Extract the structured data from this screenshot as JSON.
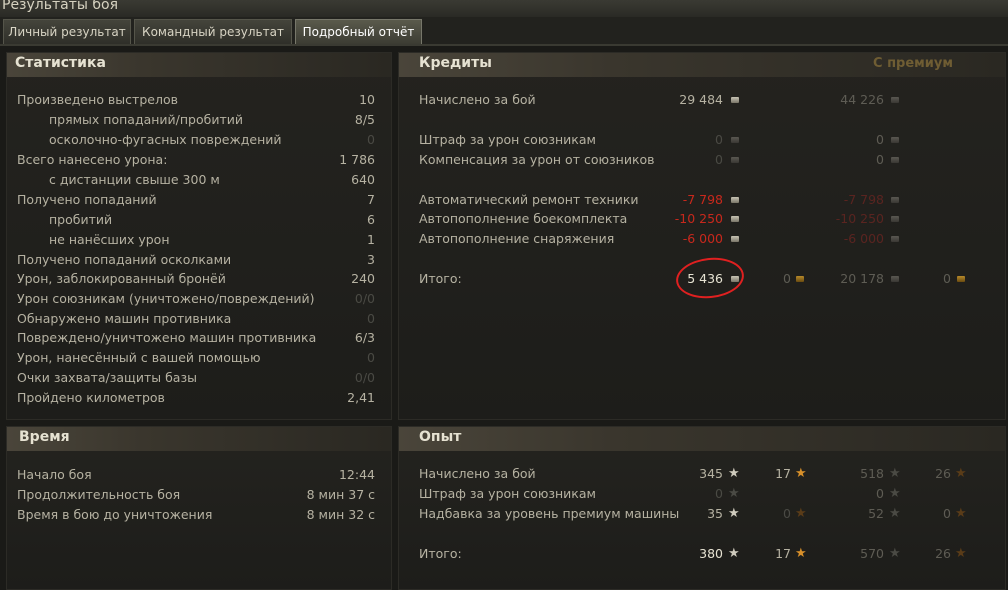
{
  "window": {
    "title": "Результаты боя"
  },
  "tabs": [
    {
      "label": "Личный результат"
    },
    {
      "label": "Командный результат"
    },
    {
      "label": "Подробный отчёт"
    }
  ],
  "stats": {
    "title": "Статистика",
    "rows": [
      {
        "label": "Произведено выстрелов",
        "value": "10"
      },
      {
        "label": "прямых попаданий/пробитий",
        "value": "8/5"
      },
      {
        "label": "осколочно-фугасных повреждений",
        "value": "0"
      },
      {
        "label": "Всего нанесено урона:",
        "value": "1 786"
      },
      {
        "label": "с дистанции свыше 300 м",
        "value": "640"
      },
      {
        "label": "Получено попаданий",
        "value": "7"
      },
      {
        "label": "пробитий",
        "value": "6"
      },
      {
        "label": "не нанёсших урон",
        "value": "1"
      },
      {
        "label": "Получено попаданий осколками",
        "value": "3"
      },
      {
        "label": "Урон, заблокированный бронёй",
        "value": "240"
      },
      {
        "label": "Урон союзникам (уничтожено/повреждений)",
        "value": "0/0"
      },
      {
        "label": "Обнаружено машин противника",
        "value": "0"
      },
      {
        "label": "Повреждено/уничтожено машин противника",
        "value": "6/3"
      },
      {
        "label": "Урон, нанесённый с вашей помощью",
        "value": "0"
      },
      {
        "label": "Очки захвата/защиты базы",
        "value": "0/0"
      },
      {
        "label": "Пройдено километров",
        "value": "2,41"
      }
    ]
  },
  "credits": {
    "title": "Кредиты",
    "premium_label": "С премиум",
    "rows": [
      {
        "label": "Начислено за бой",
        "value": "29 484",
        "premium": "44 226"
      },
      {
        "label": "Штраф за урон союзникам",
        "value": "0",
        "premium": "0"
      },
      {
        "label": "Компенсация за урон от союзников",
        "value": "0",
        "premium": "0"
      },
      {
        "label": "Автоматический ремонт техники",
        "value": "-7 798",
        "premium": "-7 798"
      },
      {
        "label": "Автопополнение боекомплекта",
        "value": "-10 250",
        "premium": "-10 250"
      },
      {
        "label": "Автопополнение снаряжения",
        "value": "-6 000",
        "premium": "-6 000"
      },
      {
        "label": "Итого:",
        "value": "5 436",
        "gold": "0",
        "premium": "20 178",
        "premium_gold": "0"
      }
    ]
  },
  "time": {
    "title": "Время",
    "rows": [
      {
        "label": "Начало боя",
        "value": "12:44"
      },
      {
        "label": "Продолжительность боя",
        "value": "8 мин 37 с"
      },
      {
        "label": "Время в бою до уничтожения",
        "value": "8 мин 32 с"
      }
    ]
  },
  "xp": {
    "title": "Опыт",
    "rows": [
      {
        "label": "Начислено за бой",
        "xp": "345",
        "free": "17",
        "prem_xp": "518",
        "prem_free": "26"
      },
      {
        "label": "Штраф за урон союзникам",
        "xp": "0",
        "prem_xp": "0"
      },
      {
        "label": "Надбавка за уровень премиум машины",
        "xp": "35",
        "free": "0",
        "prem_xp": "52",
        "prem_free": "0"
      },
      {
        "label": "Итого:",
        "xp": "380",
        "free": "17",
        "prem_xp": "570",
        "prem_free": "26"
      }
    ]
  },
  "icons": {
    "credit": "credit-coin-icon",
    "gold": "gold-coin-icon",
    "xp": "xp-star-icon",
    "free_xp": "free-xp-star-icon"
  },
  "colors": {
    "negative": "#c8281c",
    "annotation": "#e02020",
    "header_bg": "#4a453a"
  }
}
